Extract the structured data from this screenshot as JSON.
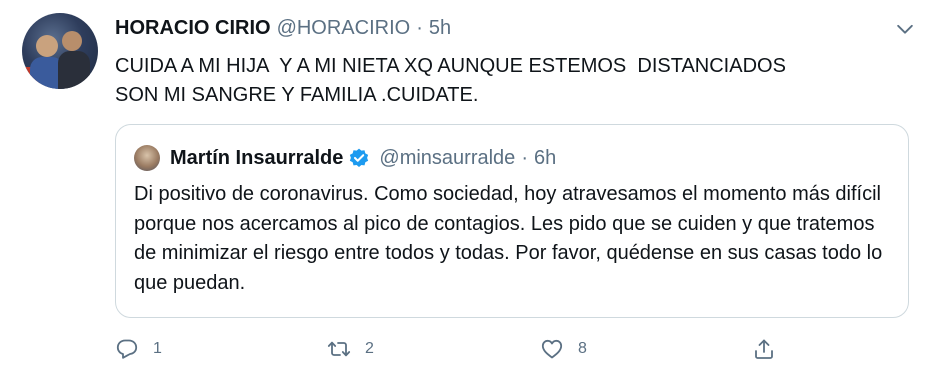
{
  "tweet": {
    "author_name": "HORACIO CIRIO",
    "author_handle": "@HORACIRIO",
    "separator": "·",
    "time": "5h",
    "text": "CUIDA A MI HIJA  Y A MI NIETA XQ AUNQUE ESTEMOS  DISTANCIADOS\nSON MI SANGRE Y FAMILIA .CUIDATE."
  },
  "quote": {
    "author_name": "Martín Insaurralde",
    "author_handle": "@minsaurralde",
    "separator": "·",
    "time": "6h",
    "text": "Di positivo de coronavirus. Como sociedad, hoy atravesamos el momento más difícil porque nos acercamos al pico de contagios. Les pido que se cuiden y que tratemos de minimizar el riesgo entre todos y todas. Por favor, quédense en sus casas todo lo que puedan."
  },
  "actions": {
    "reply_count": "1",
    "retweet_count": "2",
    "like_count": "8"
  },
  "icons": {
    "more": "chevron-down-icon",
    "verified": "verified-badge-icon",
    "reply": "reply-icon",
    "retweet": "retweet-icon",
    "like": "heart-icon",
    "share": "share-icon"
  },
  "colors": {
    "text": "#0f1419",
    "secondary": "#5b7083",
    "verified": "#1d9bf0",
    "border": "#cfd9de"
  }
}
